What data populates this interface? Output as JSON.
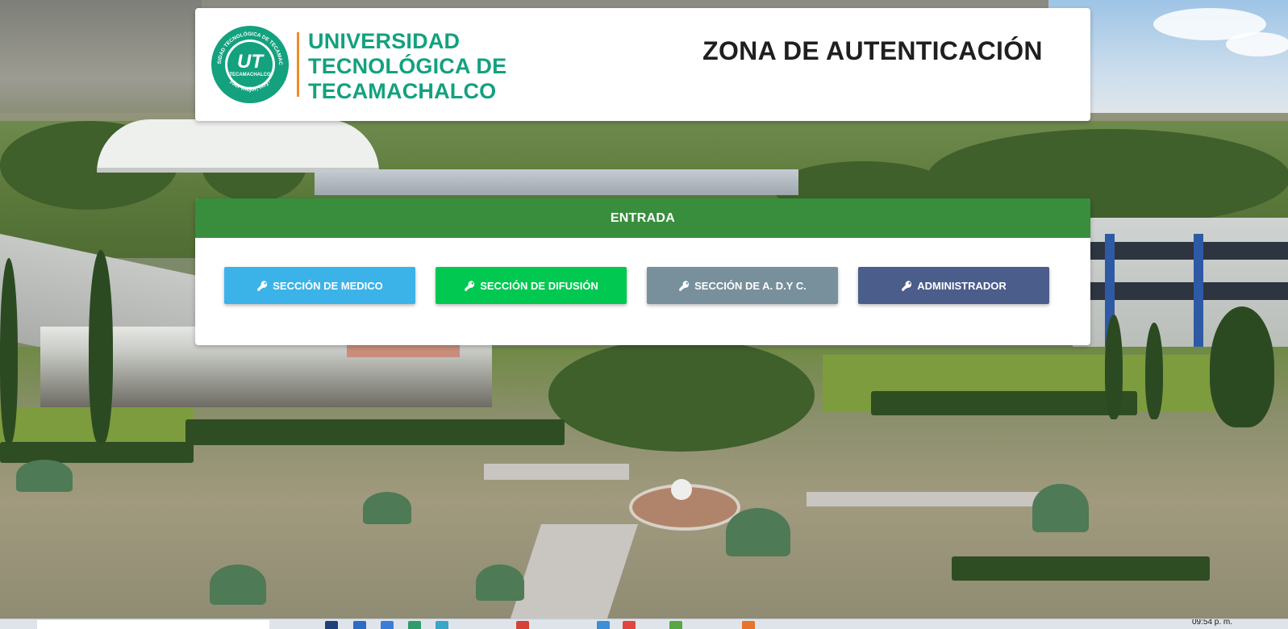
{
  "header": {
    "logo": {
      "ring_text": "UNIVERSIDAD TECNOLÓGICA DE TECAMACHALCO",
      "badge": "UT",
      "badge_caption": "TECAMACHALCO",
      "motto": "¡Ser mejor, hoy!",
      "lines": [
        "UNIVERSIDAD",
        "TECNOLÓGICA DE",
        "TECAMACHALCO"
      ]
    },
    "title": "ZONA DE AUTENTICACIÓN"
  },
  "login_panel": {
    "heading": "ENTRADA",
    "buttons": [
      {
        "label": "SECCIÓN DE MEDICO",
        "icon": "key-icon",
        "color": "#3cb3e8"
      },
      {
        "label": "SECCIÓN DE DIFUSIÓN",
        "icon": "key-icon",
        "color": "#00c851"
      },
      {
        "label": "SECCIÓN DE A. D.Y C.",
        "icon": "key-icon",
        "color": "#78909c"
      },
      {
        "label": "ADMINISTRADOR",
        "icon": "key-icon",
        "color": "#4b5d8a"
      }
    ]
  },
  "taskbar": {
    "clock": "09:54 p. m."
  },
  "colors": {
    "brand_green": "#13a17e",
    "brand_orange": "#f08c28",
    "panel_header": "#388e3c",
    "title_text": "#1f1f1f"
  }
}
